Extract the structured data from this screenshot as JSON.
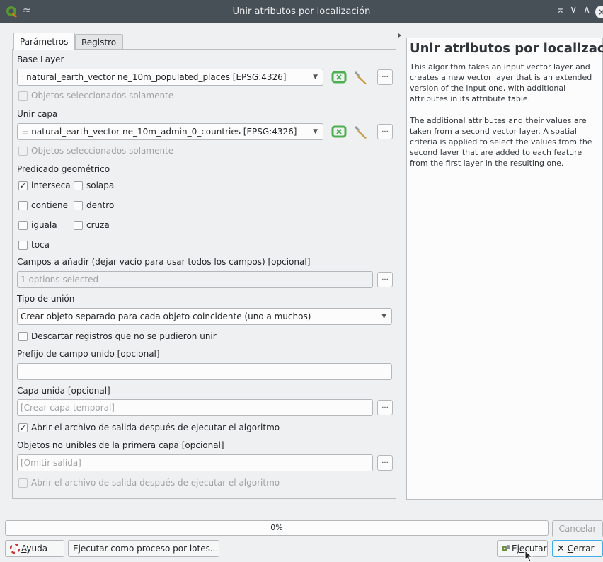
{
  "window": {
    "title": "Unir atributos por localización",
    "controls": {
      "pin": "≈",
      "shade": "⌅",
      "minimize": "∨",
      "maximize": "∧",
      "close": "×"
    }
  },
  "tabs": [
    {
      "label": "Parámetros"
    },
    {
      "label": "Registro"
    }
  ],
  "params": {
    "base_layer_label": "Base Layer",
    "base_layer_value": "natural_earth_vector ne_10m_populated_places [EPSG:4326]",
    "base_selected_only": "Objetos seleccionados solamente",
    "join_layer_label": "Unir capa",
    "join_layer_value": "natural_earth_vector ne_10m_admin_0_countries [EPSG:4326]",
    "join_selected_only": "Objetos seleccionados solamente",
    "predicate_label": "Predicado geométrico",
    "predicates": {
      "interseca": "interseca",
      "solapa": "solapa",
      "contiene": "contiene",
      "dentro": "dentro",
      "iguala": "iguala",
      "cruza": "cruza",
      "toca": "toca"
    },
    "fields_label": "Campos a añadir (dejar vacío para usar todos los campos) [opcional]",
    "fields_value": "1 options selected",
    "join_type_label": "Tipo de unión",
    "join_type_value": "Crear objeto separado para cada objeto coincidente (uno a muchos)",
    "discard_label": "Descartar registros que no se pudieron unir",
    "prefix_label": "Prefijo de campo unido [opcional]",
    "prefix_value": "",
    "output_label": "Capa unida [opcional]",
    "output_placeholder": "[Crear capa temporal]",
    "open_output_label": "Abrir el archivo de salida después de ejecutar el algoritmo",
    "nonjoinable_label": "Objetos no unibles de la primera capa [opcional]",
    "nonjoinable_placeholder": "[Omitir salida]",
    "open_nonjoinable_label": "Abrir el archivo de salida después de ejecutar el algoritmo",
    "dots": "..."
  },
  "help": {
    "title": "Unir atributos por localización",
    "para1": "This algorithm takes an input vector layer and creates a new vector layer that is an extended version of the input one, with additional attributes in its attribute table.",
    "para2": "The additional attributes and their values are taken from a second vector layer. A spatial criteria is applied to select the values from the second layer that are added to each feature from the first layer in the resulting one."
  },
  "footer": {
    "progress_text": "0%",
    "progress": 0,
    "cancel_label": "Cancelar",
    "help_key": "A",
    "help_rest": "yuda",
    "batch_label": "Ejecutar como proceso por lotes...",
    "run_pre": "Ej",
    "run_key": "e",
    "run_post": "cutar",
    "close_key": "C",
    "close_rest": "errar"
  },
  "colors": {
    "titlebar": "#475057",
    "window": "#eff0f1",
    "accent": "#3daee9",
    "qgis_green": "#589632"
  }
}
